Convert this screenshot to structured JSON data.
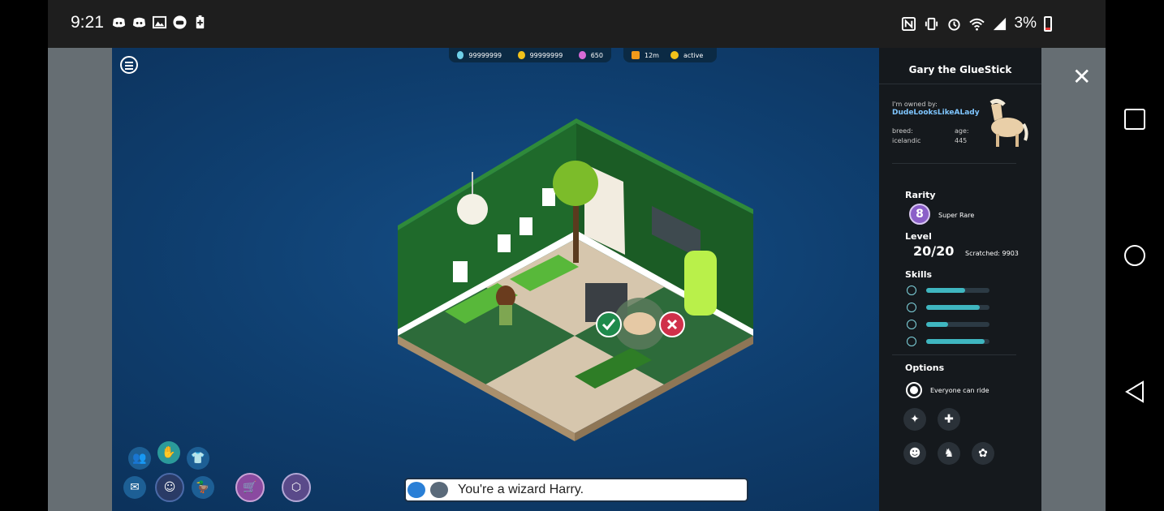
{
  "status_bar": {
    "time": "9:21",
    "battery_percent": "3%",
    "left_icons": [
      "discord-icon",
      "discord-icon",
      "image-icon",
      "game-controller-icon",
      "battery-saver-icon"
    ],
    "right_icons": [
      "nfc-icon",
      "vibrate-icon",
      "alarm-icon",
      "wifi-icon",
      "signal-icon",
      "battery-icon"
    ]
  },
  "top_bar": {
    "diamonds": "99999999",
    "credits": "99999999",
    "duckets": "650",
    "timer": "12m",
    "status": "active"
  },
  "pet_panel": {
    "pet_name": "Gary the GlueStick",
    "owner_label": "I'm owned by:",
    "owner_name": "DudeLooksLikeALady",
    "breed_label": "breed:",
    "breed_value": "icelandic",
    "age_label": "age:",
    "age_value": "445",
    "rarity_label": "Rarity",
    "rarity_number": "8",
    "rarity_text": "Super Rare",
    "level_label": "Level",
    "level_value": "20/20",
    "scratched_text": "Scratched: 9903",
    "skills_label": "Skills",
    "skills": [
      {
        "icon": "happiness-icon",
        "fill": 0.62
      },
      {
        "icon": "xp-icon",
        "fill": 0.85
      },
      {
        "icon": "energy-icon",
        "fill": 0.35
      },
      {
        "icon": "compass-icon",
        "fill": 0.92
      }
    ],
    "options_label": "Options",
    "option_ride": "Everyone can ride",
    "action_icons": [
      "pet-action-1-icon",
      "pet-action-2-icon",
      "pet-action-3-icon",
      "pet-action-4-icon",
      "pet-action-5-icon"
    ]
  },
  "chat": {
    "text": "You're a wizard Harry."
  },
  "colors": {
    "accent_teal": "#3fb6c0",
    "panel_bg": "#15191d",
    "game_bg": "#0f3f70",
    "confirm_green": "#1f8a4c",
    "cancel_red": "#d0304a"
  }
}
